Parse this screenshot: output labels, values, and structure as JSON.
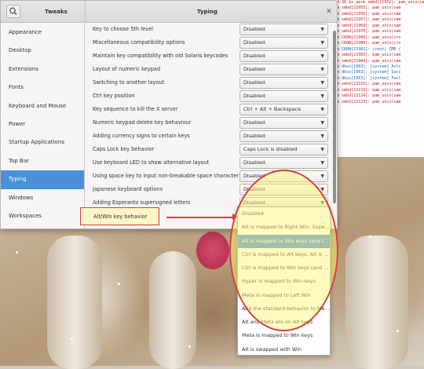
{
  "window": {
    "app_title": "Tweaks",
    "section_title": "Typing",
    "close_glyph": "✕"
  },
  "sidebar": {
    "items": [
      {
        "label": "Appearance"
      },
      {
        "label": "Desktop"
      },
      {
        "label": "Extensions"
      },
      {
        "label": "Fonts"
      },
      {
        "label": "Keyboard and Mouse"
      },
      {
        "label": "Power"
      },
      {
        "label": "Startup Applications"
      },
      {
        "label": "Top Bar"
      },
      {
        "label": "Typing"
      },
      {
        "label": "Windows"
      },
      {
        "label": "Workspaces"
      }
    ],
    "active": "Typing"
  },
  "rows": [
    {
      "label": "Key to choose 5th level",
      "value": "Disabled"
    },
    {
      "label": "Miscellaneous compatibility options",
      "value": "Disabled"
    },
    {
      "label": "Maintain key compatibility with old Solaris keycodes",
      "value": "Disabled"
    },
    {
      "label": "Layout of numeric keypad",
      "value": "Disabled"
    },
    {
      "label": "Switching to another layout",
      "value": "Disabled"
    },
    {
      "label": "Ctrl key position",
      "value": "Disabled"
    },
    {
      "label": "Key sequence to kill the X server",
      "value": "Ctrl + Alt + Backspace"
    },
    {
      "label": "Numeric keypad delete key behaviour",
      "value": "Disabled"
    },
    {
      "label": "Adding currency signs to certain keys",
      "value": "Disabled"
    },
    {
      "label": "Caps Lock key behavior",
      "value": "Caps Lock is disabled"
    },
    {
      "label": "Use keyboard LED to show alternative layout",
      "value": "Disabled"
    },
    {
      "label": "Using space key to input non-breakable space character",
      "value": "Disabled"
    },
    {
      "label": "Japanese keyboard options",
      "value": "Disabled"
    },
    {
      "label": "Adding Esperanto supersigned letters",
      "value": "Disabled"
    }
  ],
  "highlighted_row": {
    "label": "Alt/Win key behavior"
  },
  "dropdown": {
    "options": [
      "Disabled",
      "Alt is mapped to Right Win, Supe...",
      "Alt is mapped to Win keys (and t...",
      "Ctrl is mapped to Alt keys, Alt is ...",
      "Ctrl is mapped to Win keys (and ...",
      "Hyper is mapped to Win-keys",
      "Meta is mapped to Left Win",
      "Add the standard behavior to Me...",
      "Alt and Meta are on Alt keys",
      "Meta is mapped to Win keys",
      "Alt is swapped with Win"
    ],
    "selected_index": 2
  },
  "terminal": {
    "lines": [
      {
        "text": "Oct 26 16:14:36 bs perm smbd[21952]: pam_unix(sam",
        "color": "red"
      },
      {
        "text": "5:14:36 perm smbd[21955]: pam_unix(sam",
        "color": "red"
      },
      {
        "text": "5:14:36 perm smbd[21956]: pam_unix(sam",
        "color": "red"
      },
      {
        "text": "5:15:24 perm smbd[21957]: pam_unix(sam",
        "color": "red"
      },
      {
        "text": "5:15:24 perm smbd[21969]: pam_unix(sam",
        "color": "red"
      },
      {
        "text": "5:16:48 perm smbd[21976]: pam_unix(sam",
        "color": "red"
      },
      {
        "text": "5:17:01 perm CRON[21980]: pam_unix(cro",
        "color": "red"
      },
      {
        "text": "5:17:01 perm CRON[21980]: pam_unix(cro",
        "color": "red"
      },
      {
        "text": "5:17:01 perm CRON[21981]: (root) CMD (",
        "color": "blue"
      },
      {
        "text": "5:17:24 perm smbd[21983]: pam_unix(sam",
        "color": "red"
      },
      {
        "text": "5:17:24 perm smbd[21984]: pam_unix(sam",
        "color": "red"
      },
      {
        "text": "5:18:01 perm dbus[1063]: [system] Acti",
        "color": "blue"
      },
      {
        "text": "5:18:01 perm dbus[1063]: [system] Succ",
        "color": "blue"
      },
      {
        "text": "5:18:01 perm dbus[1063]: [system] Fail",
        "color": "blue"
      },
      {
        "text": "5:19:11 perm smbd[22115]: pam_unix(sam",
        "color": "red"
      },
      {
        "text": "5:19:11 perm smbd[22119]: pam_unix(sam",
        "color": "red"
      },
      {
        "text": "5:19:24 perm smbd[22124]: pam_unix(sam",
        "color": "red"
      },
      {
        "text": "5:19:24 perm smbd[22123]: pam_unix(sam",
        "color": "red"
      }
    ]
  },
  "colors": {
    "accent": "#4a90d9",
    "annotation_red": "#d93f3f",
    "annotation_yellow": "#fff678"
  }
}
